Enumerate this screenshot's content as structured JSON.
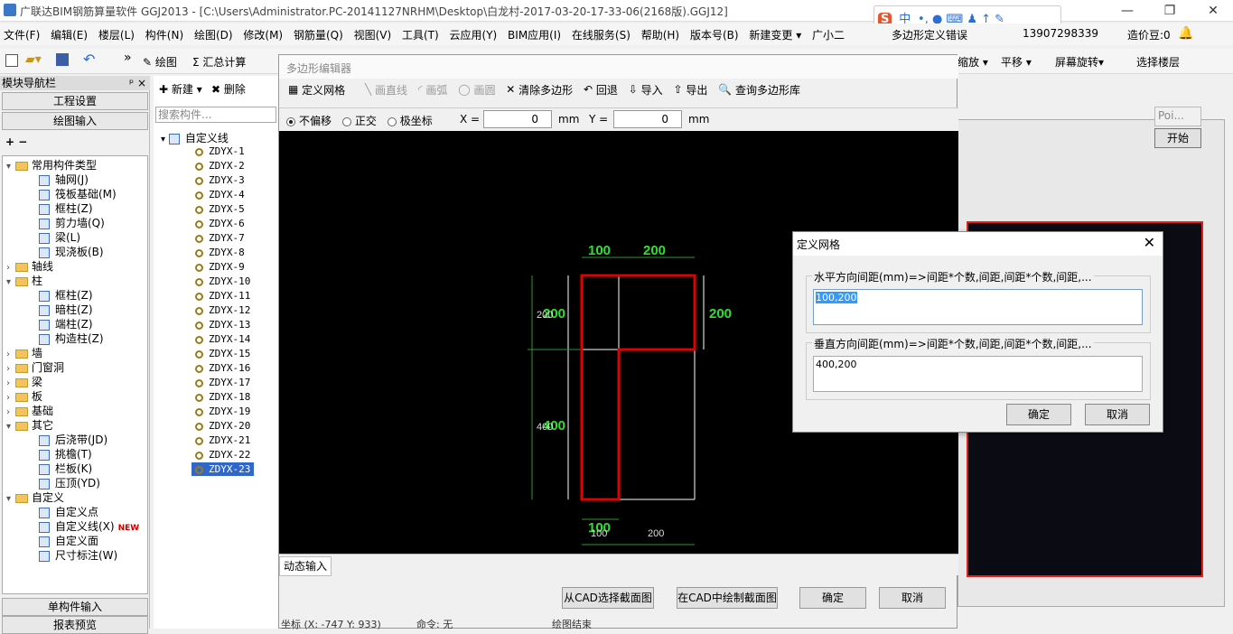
{
  "titlebar": {
    "title": "广联达BIM钢筋算量软件 GGJ2013 - [C:\\Users\\Administrator.PC-20141127NRHM\\Desktop\\白龙村-2017-03-20-17-33-06(2168版).GGJ12]"
  },
  "ime": {
    "s": "S",
    "zh": "中",
    "rest": "•, ● ⌨ ♟ ↑ ✎"
  },
  "menu": [
    "文件(F)",
    "编辑(E)",
    "楼层(L)",
    "构件(N)",
    "绘图(D)",
    "修改(M)",
    "钢筋量(Q)",
    "视图(V)",
    "工具(T)",
    "云应用(Y)",
    "BIM应用(I)",
    "在线服务(S)",
    "帮助(H)",
    "版本号(B)",
    "新建变更 ▾",
    "广小二"
  ],
  "menu_right": {
    "error": "多边形定义错误",
    "phone": "13907298339",
    "beans": "造价豆:0"
  },
  "toolbar": {
    "draw": "绘图",
    "sum": "Σ 汇总计算",
    "zoom": "缩放 ▾",
    "pan": "平移 ▾",
    "rotate": "屏幕旋转▾",
    "floor": "选择楼层"
  },
  "nav": {
    "title": "模块导航栏",
    "pin": "ᵖ ×",
    "project": "工程设置",
    "draw_input": "绘图输入",
    "single": "单构件输入",
    "report": "报表预览"
  },
  "tree": [
    {
      "t": "▾",
      "label": "常用构件类型",
      "kind": "folder",
      "lvl": 0
    },
    {
      "t": "",
      "label": "轴网(J)",
      "kind": "icon",
      "lvl": 1
    },
    {
      "t": "",
      "label": "筏板基础(M)",
      "kind": "icon",
      "lvl": 1
    },
    {
      "t": "",
      "label": "框柱(Z)",
      "kind": "icon",
      "lvl": 1
    },
    {
      "t": "",
      "label": "剪力墙(Q)",
      "kind": "icon",
      "lvl": 1
    },
    {
      "t": "",
      "label": "梁(L)",
      "kind": "icon",
      "lvl": 1
    },
    {
      "t": "",
      "label": "现浇板(B)",
      "kind": "icon",
      "lvl": 1
    },
    {
      "t": "›",
      "label": "轴线",
      "kind": "folder",
      "lvl": 0
    },
    {
      "t": "▾",
      "label": "柱",
      "kind": "folder",
      "lvl": 0
    },
    {
      "t": "",
      "label": "框柱(Z)",
      "kind": "icon",
      "lvl": 1
    },
    {
      "t": "",
      "label": "暗柱(Z)",
      "kind": "icon",
      "lvl": 1
    },
    {
      "t": "",
      "label": "端柱(Z)",
      "kind": "icon",
      "lvl": 1
    },
    {
      "t": "",
      "label": "构造柱(Z)",
      "kind": "icon",
      "lvl": 1
    },
    {
      "t": "›",
      "label": "墙",
      "kind": "folder",
      "lvl": 0
    },
    {
      "t": "›",
      "label": "门窗洞",
      "kind": "folder",
      "lvl": 0
    },
    {
      "t": "›",
      "label": "梁",
      "kind": "folder",
      "lvl": 0
    },
    {
      "t": "›",
      "label": "板",
      "kind": "folder",
      "lvl": 0
    },
    {
      "t": "›",
      "label": "基础",
      "kind": "folder",
      "lvl": 0
    },
    {
      "t": "▾",
      "label": "其它",
      "kind": "folder",
      "lvl": 0
    },
    {
      "t": "",
      "label": "后浇带(JD)",
      "kind": "icon",
      "lvl": 1
    },
    {
      "t": "",
      "label": "挑檐(T)",
      "kind": "icon",
      "lvl": 1
    },
    {
      "t": "",
      "label": "栏板(K)",
      "kind": "icon",
      "lvl": 1
    },
    {
      "t": "",
      "label": "压顶(YD)",
      "kind": "icon",
      "lvl": 1
    },
    {
      "t": "▾",
      "label": "自定义",
      "kind": "folder",
      "lvl": 0
    },
    {
      "t": "",
      "label": "自定义点",
      "kind": "icon",
      "lvl": 1
    },
    {
      "t": "",
      "label": "自定义线(X)",
      "kind": "icon",
      "lvl": 1,
      "badge": "NEW"
    },
    {
      "t": "",
      "label": "自定义面",
      "kind": "icon",
      "lvl": 1
    },
    {
      "t": "",
      "label": "尺寸标注(W)",
      "kind": "icon",
      "lvl": 1
    }
  ],
  "components": {
    "new": "新建 ▾",
    "delete": "删除",
    "search_placeholder": "搜索构件...",
    "root": "自定义线",
    "items": [
      "ZDYX-1",
      "ZDYX-2",
      "ZDYX-3",
      "ZDYX-4",
      "ZDYX-5",
      "ZDYX-6",
      "ZDYX-7",
      "ZDYX-8",
      "ZDYX-9",
      "ZDYX-10",
      "ZDYX-11",
      "ZDYX-12",
      "ZDYX-13",
      "ZDYX-14",
      "ZDYX-15",
      "ZDYX-16",
      "ZDYX-17",
      "ZDYX-18",
      "ZDYX-19",
      "ZDYX-20",
      "ZDYX-21",
      "ZDYX-22",
      "ZDYX-23"
    ],
    "selected": "ZDYX-23"
  },
  "poly": {
    "title": "多边形编辑器",
    "tools": [
      "定义网格",
      "画直线",
      "画弧",
      "画圆",
      "清除多边形",
      "回退",
      "导入",
      "导出",
      "查询多边形库"
    ],
    "opts": {
      "no_offset": "不偏移",
      "ortho": "正交",
      "polar": "极坐标",
      "x_label": "X =",
      "x": "0",
      "y_label": "Y =",
      "y": "0",
      "unit": "mm"
    },
    "dims": {
      "top1": "100",
      "top2": "200",
      "right": "200",
      "left_top_a": "200",
      "left_top_b": "200",
      "left_bot_a": "400",
      "left_bot_b": "400",
      "bot_a": "100",
      "bot_b": "100",
      "bot_c": "200"
    },
    "dyn": "动态输入",
    "btn_cad_select": "从CAD选择截面图",
    "btn_cad_draw": "在CAD中绘制截面图",
    "ok": "确定",
    "cancel": "取消",
    "status": {
      "coord": "坐标 (X: -747 Y: 933)",
      "cmd": "命令: 无",
      "state": "绘图结束"
    }
  },
  "grid": {
    "title": "定义网格",
    "h_label": "水平方向间距(mm)=>间距*个数,间距,间距*个数,间距,...",
    "h_value": "100,200",
    "v_label": "垂直方向间距(mm)=>间距*个数,间距,间距*个数,间距,...",
    "v_value": "400,200",
    "ok": "确定",
    "cancel": "取消"
  },
  "right": {
    "poi": "Poi...",
    "start": "开始"
  }
}
